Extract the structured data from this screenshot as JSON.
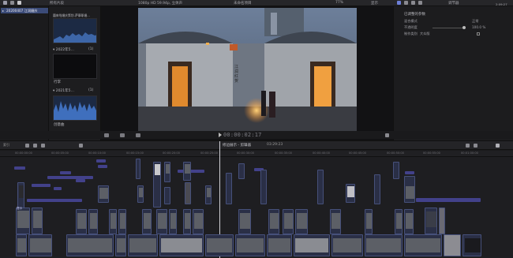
{
  "app": {
    "library_tab": "所有片段",
    "viewer_info": "1080p HD 59.94p, 立体声",
    "project_name": "未命名项目",
    "zoom": "77%",
    "view_menu": "显示"
  },
  "sidebar": {
    "event_label": "20200407 江润婚庆"
  },
  "browser": {
    "items": [
      {
        "label": "囍来啦婚庆策划-萨摩耶婚…",
        "count": ""
      },
      {
        "label": "2022年5…",
        "count": "(1)"
      },
      {
        "label": "行李",
        "count": ""
      },
      {
        "label": "2021年5…",
        "count": "(1)"
      },
      {
        "label": "创意曲",
        "count": ""
      }
    ],
    "selection_count": "504 项"
  },
  "viewer": {
    "sign_text": "江 润 红 贺",
    "timecode": "00:00:02:17"
  },
  "inspector": {
    "title": "已调整的参数",
    "rows": [
      {
        "label": "混合模式",
        "value": "正常"
      },
      {
        "label": "不透明度",
        "value": "100.0 %"
      },
      {
        "label": "制作类别",
        "value": "大众版"
      }
    ],
    "duration": "2:09:27",
    "tab": "调节器"
  },
  "timeline": {
    "index_label": "索引",
    "project_label": "修边展示 - 剪辑器",
    "duration_label": "03:29:23",
    "ruler": [
      "00:00:00:00",
      "00:00:05:00",
      "00:00:10:00",
      "00:00:15:00",
      "00:00:20:00",
      "00:00:25:00",
      "00:00:30:00",
      "00:00:35:00",
      "00:00:40:00",
      "00:00:45:00",
      "00:00:50:00",
      "00:00:55:00",
      "00:01:00:00"
    ],
    "track_label": "提示"
  },
  "colors": {
    "accent": "#5a5a8e",
    "viewer_lamp": "#f29a36",
    "timeline_bg": "#1e1e21"
  }
}
